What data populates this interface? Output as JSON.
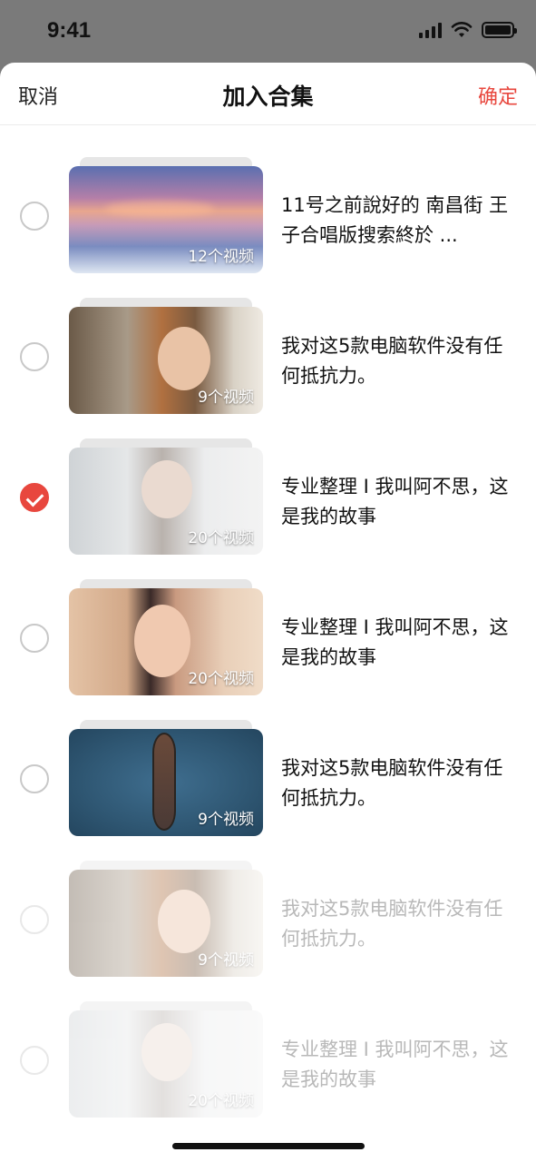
{
  "status_bar": {
    "time": "9:41"
  },
  "header": {
    "cancel": "取消",
    "title": "加入合集",
    "confirm": "确定"
  },
  "colors": {
    "accent": "#e8473e"
  },
  "collections": [
    {
      "title": "11号之前說好的 南昌街 王子合唱版搜索終於 ...",
      "count": "12个视频",
      "image": "lake-sunset",
      "selected": false,
      "dimmed": false
    },
    {
      "title": "我对这5款电脑软件没有任何抵抗力。",
      "count": "9个视频",
      "image": "woman-portrait",
      "selected": false,
      "dimmed": false
    },
    {
      "title": "专业整理 I 我叫阿不思，这是我的故事",
      "count": "20个视频",
      "image": "man-portrait",
      "selected": true,
      "dimmed": false
    },
    {
      "title": "专业整理 I 我叫阿不思，这是我的故事",
      "count": "20个视频",
      "image": "woman-portrait-2",
      "selected": false,
      "dimmed": false
    },
    {
      "title": "我对这5款电脑软件没有任何抵抗力。",
      "count": "9个视频",
      "image": "boat-aerial",
      "selected": false,
      "dimmed": false
    },
    {
      "title": "我对这5款电脑软件没有任何抵抗力。",
      "count": "9个视频",
      "image": "woman-portrait",
      "selected": false,
      "dimmed": true
    },
    {
      "title": "专业整理 I 我叫阿不思，这是我的故事",
      "count": "20个视频",
      "image": "man-portrait",
      "selected": false,
      "dimmed": true
    }
  ]
}
